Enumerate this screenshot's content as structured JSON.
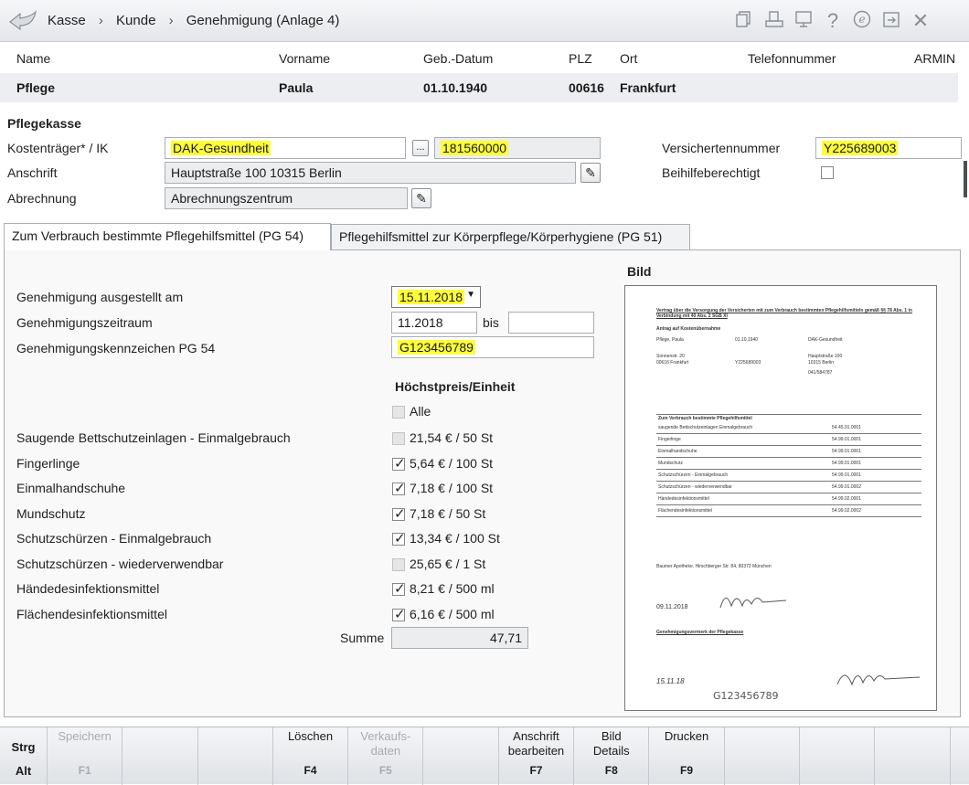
{
  "breadcrumb": [
    "Kasse",
    "Kunde",
    "Genehmigung (Anlage 4)"
  ],
  "breadcrumb_sep": "›",
  "user": "ARMIN",
  "patient": {
    "headers": {
      "name": "Name",
      "vorname": "Vorname",
      "geb": "Geb.-Datum",
      "plz": "PLZ",
      "ort": "Ort",
      "tel": "Telefonnummer"
    },
    "values": {
      "name": "Pflege",
      "vorname": "Paula",
      "geb": "01.10.1940",
      "plz": "00616",
      "ort": "Frankfurt",
      "tel": ""
    }
  },
  "pflegekasse": {
    "section_title": "Pflegekasse",
    "kostentraeger_label": "Kostenträger* / IK",
    "kostentraeger_value": "DAK-Gesundheit",
    "ik_value": "181560000",
    "lookup_btn": "...",
    "anschrift_label": "Anschrift",
    "anschrift_value": "Hauptstraße 100 10315 Berlin",
    "abrechnung_label": "Abrechnung",
    "abrechnung_value": "Abrechnungszentrum",
    "versnr_label": "Versichertennummer",
    "versnr_value": "Y225689003",
    "beihilfe_label": "Beihilfeberechtigt"
  },
  "tabs": [
    {
      "label": "Zum Verbrauch bestimmte Pflegehilfsmittel (PG 54)",
      "active": true
    },
    {
      "label": "Pflegehilfsmittel zur Körperpflege/Körperhygiene (PG 51)",
      "active": false
    }
  ],
  "genehmigung": {
    "ausgestellt_label": "Genehmigung ausgestellt am",
    "ausgestellt_value": "15.11.2018",
    "zeitraum_label": "Genehmigungszeitraum",
    "zeitraum_from": "11.2018",
    "bis_label": "bis",
    "zeitraum_to": "",
    "kennzeichen_label": "Genehmigungskennzeichen PG 54",
    "kennzeichen_value": "G123456789"
  },
  "items_header": "Höchstpreis/Einheit",
  "alle_label": "Alle",
  "items": [
    {
      "label": "Saugende Bettschutzeinlagen - Einmalgebrauch",
      "price": "21,54 € / 50 St",
      "checked": false
    },
    {
      "label": "Fingerlinge",
      "price": "5,64 € / 100 St",
      "checked": true
    },
    {
      "label": "Einmalhandschuhe",
      "price": "7,18 € / 100 St",
      "checked": true
    },
    {
      "label": "Mundschutz",
      "price": "7,18 € / 50 St",
      "checked": true
    },
    {
      "label": "Schutzschürzen - Einmalgebrauch",
      "price": "13,34 € / 100 St",
      "checked": true
    },
    {
      "label": "Schutzschürzen - wiederverwendbar",
      "price": "25,65 € / 1 St",
      "checked": false
    },
    {
      "label": "Händedesinfektionsmittel",
      "price": "8,21 € / 500 ml",
      "checked": true
    },
    {
      "label": "Flächendesinfektionsmittel",
      "price": "6,16 € / 500 ml",
      "checked": true
    }
  ],
  "summe_label": "Summe",
  "summe_value": "47,71",
  "bild_label": "Bild",
  "bild_doc": {
    "title": "Vertrag über die Versorgung der Versicherten mit zum Verbrauch bestimmten Pflegehilfsmitteln gemäß §§ 78 Abs. 1 in Verbindung mit 40 Abs. 2 SGB XI",
    "heading": "Antrag auf Kostenübernahme",
    "name": "Pflege, Paula",
    "dob": "01.10.1940",
    "kasse": "DAK-Gesundheit",
    "street": "Sonnenstr. 20",
    "city": "00616 Frankfurt",
    "versnr": "Y225689003",
    "kasse_addr1": "Hauptstraße 100",
    "kasse_addr2": "10315 Berlin",
    "tel": "041/584787",
    "date_sig": "09.11.2018",
    "date_stamp": "15.11.18",
    "handwritten_code": "G123456789",
    "table_header": "Zum Verbrauch bestimmte Pflegehilfsmittel",
    "table_rows": [
      "saugende Bettschutzeinlagen Einmalgebrauch",
      "Fingerlinge",
      "Einmalhandschuhe",
      "Mundschutz",
      "Schutzschürzen - Einmalgebrauch",
      "Schutzschürzen - wiederverwendbar",
      "Händedesinfektionsmittel",
      "Flächendesinfektionsmittel"
    ],
    "table_codes": [
      "54.45.01.0001",
      "54.99.01.0001",
      "54.99.01.0001",
      "54.99.01.0001",
      "54.99.01.0001",
      "54.99.01.0002",
      "54.99.02.0001",
      "54.99.02.0002"
    ],
    "pharmacy": "Baumer Apotheke, Hirschberger Str. 84, 80372 München",
    "genehmigung_heading": "Genehmigungsvermerk der Pflegekasse"
  },
  "footer": {
    "modifiers": [
      "Strg",
      "Alt"
    ],
    "keys": [
      {
        "label": "Speichern",
        "key": "F1",
        "enabled": false
      },
      {
        "label": "",
        "key": "",
        "enabled": false
      },
      {
        "label": "",
        "key": "",
        "enabled": false
      },
      {
        "label": "Löschen",
        "key": "F4",
        "enabled": true
      },
      {
        "label": "Verkaufs-\ndaten",
        "key": "F5",
        "enabled": false
      },
      {
        "label": "",
        "key": "",
        "enabled": false
      },
      {
        "label": "Anschrift\nbearbeiten",
        "key": "F7",
        "enabled": true
      },
      {
        "label": "Bild\nDetails",
        "key": "F8",
        "enabled": true
      },
      {
        "label": "Drucken",
        "key": "F9",
        "enabled": true
      },
      {
        "label": "",
        "key": "",
        "enabled": false
      },
      {
        "label": "",
        "key": "",
        "enabled": false
      },
      {
        "label": "",
        "key": "",
        "enabled": false
      }
    ]
  },
  "icons": [
    "back-arrow-icon",
    "copy-icon",
    "print-icon",
    "monitor-icon",
    "help-icon",
    "e-icon",
    "export-icon",
    "close-icon"
  ]
}
